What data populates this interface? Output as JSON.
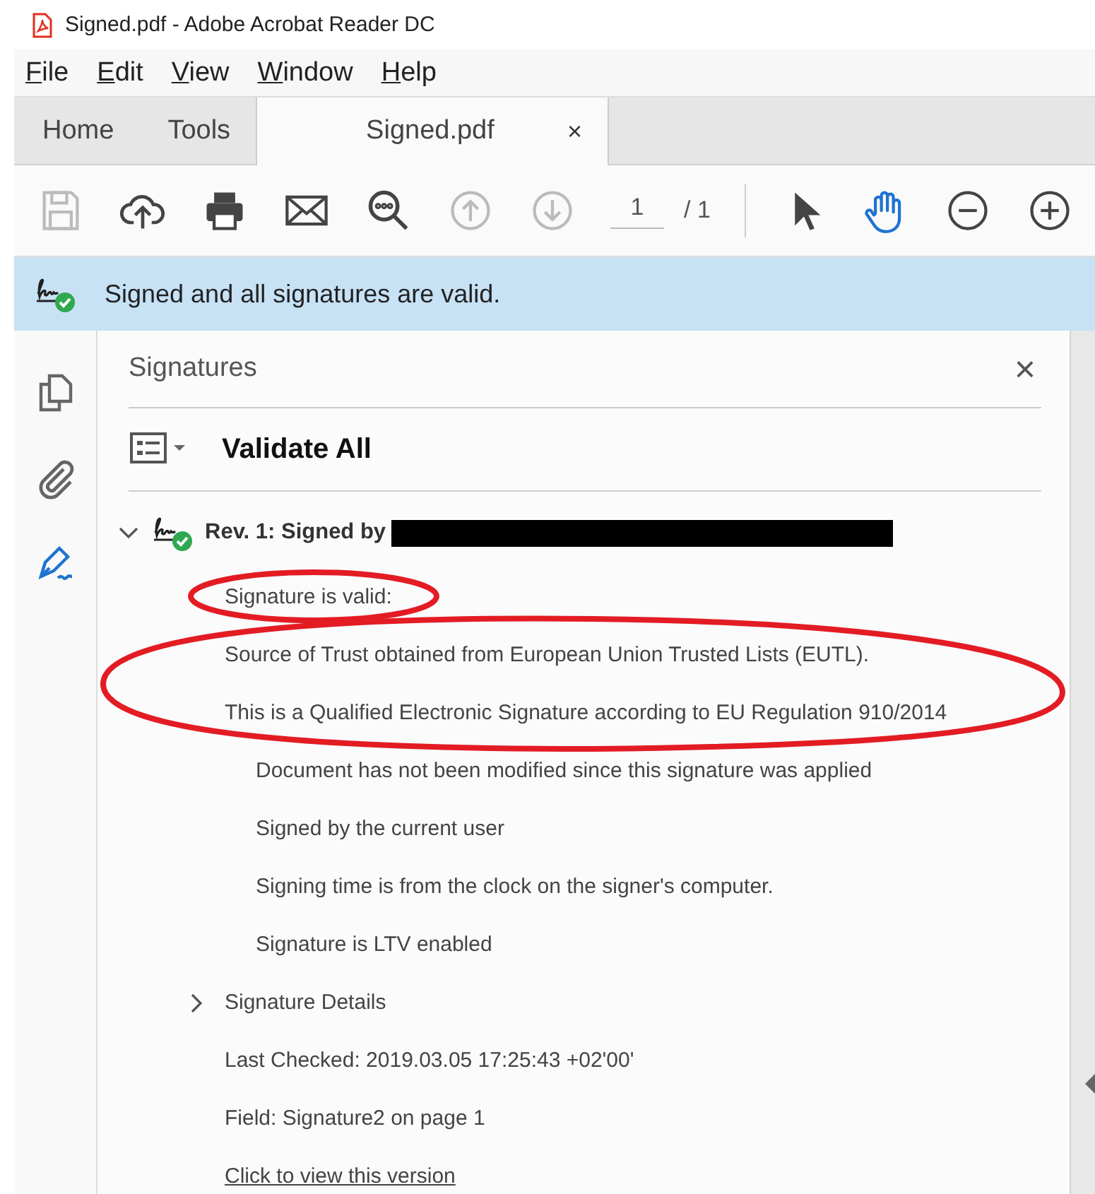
{
  "window": {
    "title": "Signed.pdf - Adobe Acrobat Reader DC"
  },
  "menu": [
    "File",
    "Edit",
    "View",
    "Window",
    "Help"
  ],
  "tabs": [
    {
      "label": "Home",
      "selected": false,
      "closable": false
    },
    {
      "label": "Tools",
      "selected": false,
      "closable": false
    },
    {
      "label": "Signed.pdf",
      "selected": true,
      "closable": true,
      "close": "×"
    }
  ],
  "toolbar": {
    "tools": [
      {
        "kind": "save",
        "disabled": true
      },
      {
        "kind": "upload",
        "disabled": false
      },
      {
        "kind": "print",
        "disabled": false
      },
      {
        "kind": "mail",
        "disabled": false
      },
      {
        "kind": "find",
        "disabled": false
      },
      {
        "kind": "up",
        "disabled": true
      },
      {
        "kind": "down",
        "disabled": true
      }
    ],
    "page_current": "1",
    "page_total": "/ 1",
    "modes": [
      {
        "kind": "pointer",
        "selected": false
      },
      {
        "kind": "hand",
        "selected": true
      }
    ],
    "zoom": [
      {
        "kind": "zoom-out",
        "disabled": false
      },
      {
        "kind": "zoom-in",
        "disabled": false
      }
    ]
  },
  "banner": {
    "text": "Signed and all signatures are valid."
  },
  "rail": [
    {
      "kind": "pages",
      "selected": false
    },
    {
      "kind": "attachment",
      "selected": false
    },
    {
      "kind": "signature",
      "selected": true
    }
  ],
  "panel": {
    "title": "Signatures",
    "close": "×",
    "validate_all": "Validate All",
    "signature": {
      "label": "Rev. 1: Signed by",
      "expanded": true,
      "items": [
        {
          "kind": "line",
          "text": "Signature is valid:"
        },
        {
          "kind": "line",
          "text": "Source of Trust obtained from European Union Trusted Lists (EUTL)."
        },
        {
          "kind": "line",
          "text": "This is a Qualified Electronic Signature according to EU Regulation 910/2014"
        },
        {
          "kind": "subline",
          "text": "Document has not been modified since this signature was applied"
        },
        {
          "kind": "subline",
          "text": "Signed by the current user"
        },
        {
          "kind": "subline",
          "text": "Signing time is from the clock on the signer's computer."
        },
        {
          "kind": "subline",
          "text": "Signature is LTV enabled"
        },
        {
          "kind": "expander",
          "text": "Signature Details",
          "expanded": false
        },
        {
          "kind": "line",
          "text": "Last Checked: 2019.03.05 17:25:43 +02'00'"
        },
        {
          "kind": "line",
          "text": "Field: Signature2 on page 1"
        },
        {
          "kind": "link",
          "text": "Click to view this version"
        }
      ]
    }
  }
}
